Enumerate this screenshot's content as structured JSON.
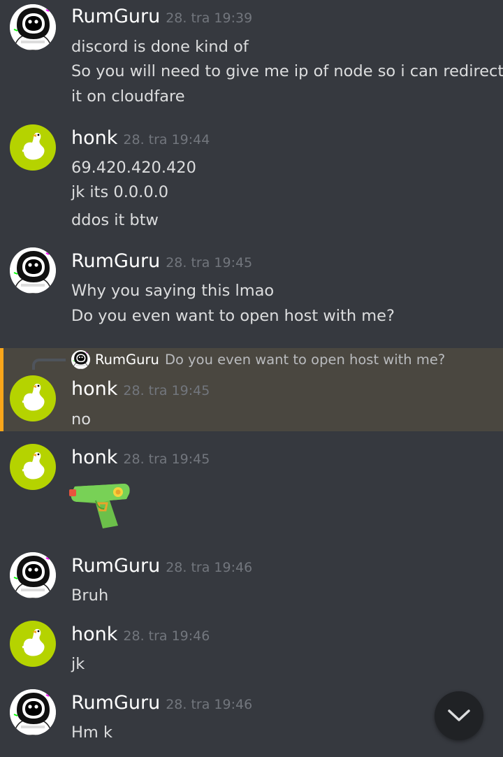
{
  "users": {
    "rumguru": {
      "name": "RumGuru",
      "avatar_icon": "astronaut-avatar-icon"
    },
    "honk": {
      "name": "honk",
      "avatar_icon": "goose-avatar-icon",
      "avatar_bg": "#b5d300"
    }
  },
  "messages": [
    {
      "author": "RumGuru",
      "time": "28. tra 19:39",
      "lines": [
        "discord is done kind of",
        "So you will need to give me ip of node so i can redirect",
        "it on cloudfare"
      ]
    },
    {
      "author": "honk",
      "time": "28. tra 19:44",
      "lines": [
        "69.420.420.420",
        "jk its 0.0.0.0",
        "ddos it btw"
      ]
    },
    {
      "author": "RumGuru",
      "time": "28. tra 19:45",
      "lines": [
        "Why you saying this lmao",
        "Do you even want to open host with me?"
      ]
    },
    {
      "author": "honk",
      "time": "28. tra 19:45",
      "lines": [
        "no"
      ],
      "reply_to": {
        "author": "RumGuru",
        "text": "Do you even want to open host with me?"
      }
    },
    {
      "author": "honk",
      "time": "28. tra 19:45",
      "emoji": "water-pistol-icon"
    },
    {
      "author": "RumGuru",
      "time": "28. tra 19:46",
      "lines": [
        "Bruh"
      ]
    },
    {
      "author": "honk",
      "time": "28. tra 19:46",
      "lines": [
        "jk"
      ]
    },
    {
      "author": "RumGuru",
      "time": "28. tra 19:46",
      "lines": [
        "Hm k"
      ]
    }
  ],
  "colors": {
    "background": "#36393f",
    "highlight": "#4a4740",
    "mention_bar": "#faa61a",
    "timestamp": "#72767d"
  },
  "scroll_button_icon": "chevron-down-icon"
}
